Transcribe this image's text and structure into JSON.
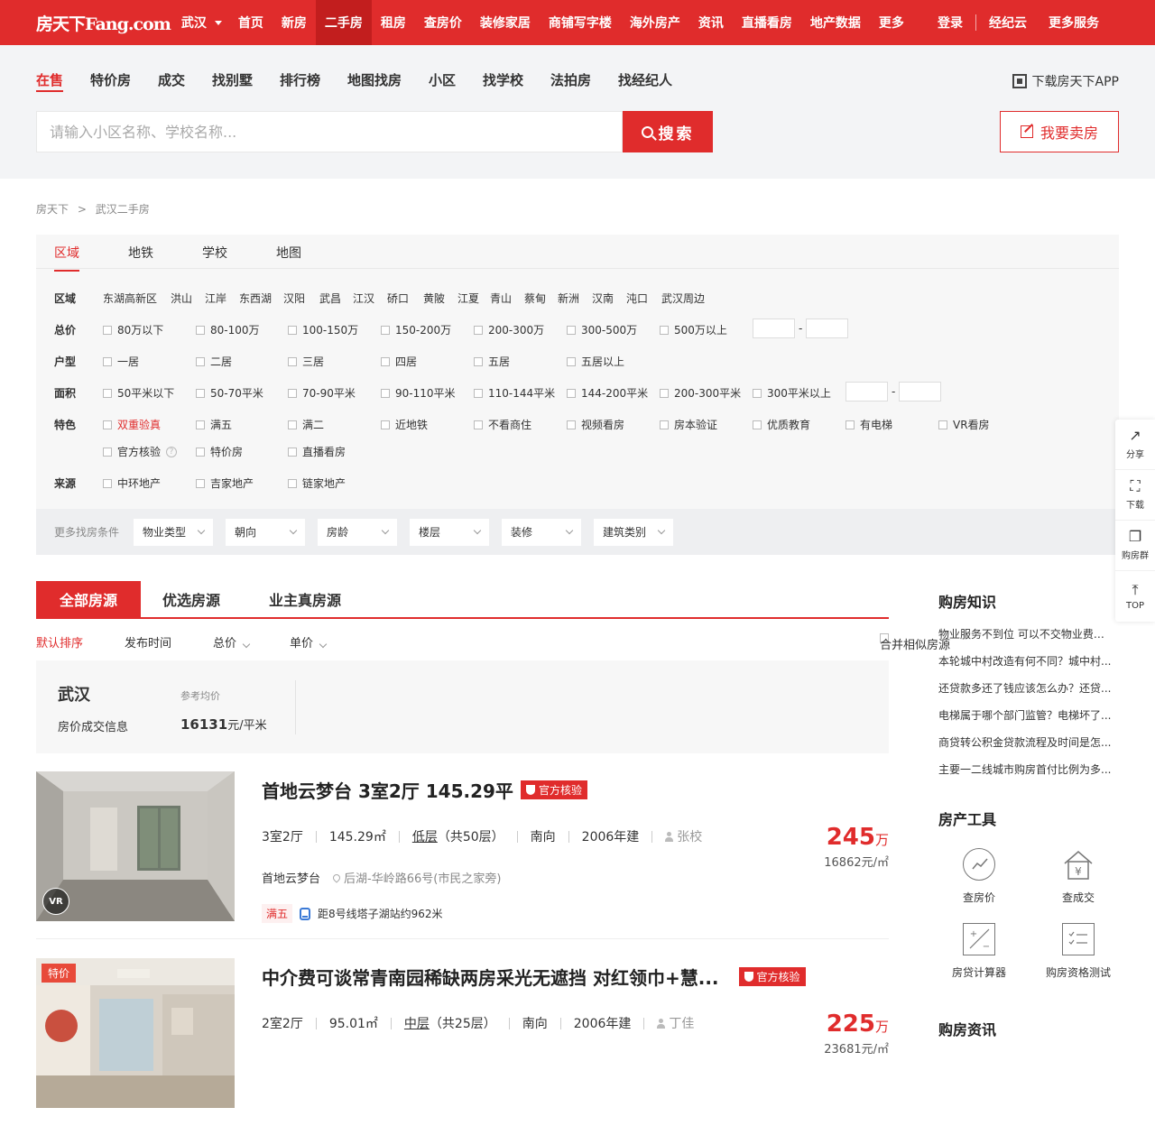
{
  "topbar": {
    "logo": "房天下Fang.com",
    "city": "武汉",
    "nav": [
      "首页",
      "新房",
      "二手房",
      "租房",
      "查房价",
      "装修家居",
      "商铺写字楼",
      "海外房产",
      "资讯",
      "直播看房",
      "地产数据",
      "更多"
    ],
    "active_nav": "二手房",
    "right": {
      "login": "登录",
      "agent": "经纪云",
      "more": "更多服务"
    }
  },
  "search": {
    "tabs": [
      "在售",
      "特价房",
      "成交",
      "找别墅",
      "排行榜",
      "地图找房",
      "小区",
      "找学校",
      "法拍房",
      "找经纪人"
    ],
    "active_tab": "在售",
    "app_download": "下载房天下APP",
    "placeholder": "请输入小区名称、学校名称...",
    "button": "搜索",
    "sell_button": "我要卖房"
  },
  "breadcrumb": [
    "房天下",
    ">",
    "武汉二手房"
  ],
  "filter": {
    "tabs": [
      "区域",
      "地铁",
      "学校",
      "地图"
    ],
    "active_tab": "区域",
    "rows": {
      "district": {
        "label": "区域",
        "options": [
          "东湖高新区",
          "洪山",
          "江岸",
          "东西湖",
          "汉阳",
          "武昌",
          "江汉",
          "硚口",
          "黄陂",
          "江夏",
          "青山",
          "蔡甸",
          "新洲",
          "汉南",
          "沌口",
          "武汉周边"
        ]
      },
      "price": {
        "label": "总价",
        "options": [
          "80万以下",
          "80-100万",
          "100-150万",
          "150-200万",
          "200-300万",
          "300-500万",
          "500万以上"
        ]
      },
      "layout": {
        "label": "户型",
        "options": [
          "一居",
          "二居",
          "三居",
          "四居",
          "五居",
          "五居以上"
        ]
      },
      "area": {
        "label": "面积",
        "options": [
          "50平米以下",
          "50-70平米",
          "70-90平米",
          "90-110平米",
          "110-144平米",
          "144-200平米",
          "200-300平米",
          "300平米以上"
        ]
      },
      "feature": {
        "label": "特色",
        "options": [
          "双重验真",
          "满五",
          "满二",
          "近地铁",
          "不看商住",
          "视频看房",
          "房本验证",
          "优质教育",
          "有电梯",
          "VR看房",
          "官方核验",
          "特价房",
          "直播看房"
        ]
      },
      "source": {
        "label": "来源",
        "options": [
          "中环地产",
          "吉家地产",
          "链家地产"
        ]
      }
    },
    "range_dash": "-",
    "more_label": "更多找房条件",
    "dropdowns": [
      "物业类型",
      "朝向",
      "房龄",
      "楼层",
      "装修",
      "建筑类别"
    ]
  },
  "list": {
    "tabs": [
      "全部房源",
      "优选房源",
      "业主真房源"
    ],
    "sort": [
      "默认排序",
      "发布时间",
      "总价",
      "单价"
    ],
    "merge": "合并相似房源"
  },
  "price_info": {
    "city": "武汉",
    "info_label": "房价成交信息",
    "ref_label": "参考均价",
    "ref_value": "16131",
    "ref_unit": "元/平米"
  },
  "listings": [
    {
      "title": "首地云梦台 3室2厅 145.29平",
      "badge": "官方核验",
      "layout": "3室2厅",
      "area": "145.29㎡",
      "floor": "低层",
      "floor_total": "（共50层）",
      "orientation": "南向",
      "built": "2006年建",
      "agent": "张校",
      "community": "首地云梦台",
      "location": "后湖-华岭路66号(市民之家旁)",
      "tag": "满五",
      "metro": "距8号线塔子湖站约962米",
      "price": "245",
      "price_unit": "万",
      "unit_price": "16862元/㎡",
      "vr": "VR"
    },
    {
      "title": "中介费可谈常青南园稀缺两房采光无遮挡 对红领巾+慧...",
      "badge": "官方核验",
      "layout": "2室2厅",
      "area": "95.01㎡",
      "floor": "中层",
      "floor_total": "（共25层）",
      "orientation": "南向",
      "built": "2006年建",
      "agent": "丁佳",
      "price": "225",
      "price_unit": "万",
      "unit_price": "23681元/㎡",
      "special": "特价"
    }
  ],
  "sidebar": {
    "knowledge_title": "购房知识",
    "knowledge": [
      "物业服务不到位 可以不交物业费吗...",
      "本轮城中村改造有何不同？城中村...",
      "还贷款多还了钱应该怎么办？还贷...",
      "电梯属于哪个部门监管？电梯坏了...",
      "商贷转公积金贷款流程及时间是怎...",
      "主要一二线城市购房首付比例为多..."
    ],
    "tools_title": "房产工具",
    "tools": [
      "查房价",
      "查成交",
      "房贷计算器",
      "购房资格测试"
    ],
    "news_title": "购房资讯"
  },
  "float": [
    "分享",
    "下载",
    "购房群",
    "TOP"
  ],
  "colors": {
    "brand_red": "#e02c2c",
    "bg_gray": "#f3f4f6"
  }
}
